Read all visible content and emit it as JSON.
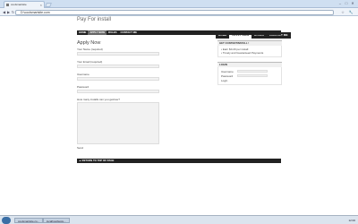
{
  "browser": {
    "tab_title": "coolsmartsite",
    "new_tab": "+",
    "window_buttons": [
      "–",
      "□",
      "✕"
    ],
    "address": "D:\\coolsmartsite.com",
    "nav": [
      "◀",
      "▶",
      "↻"
    ],
    "right_tools": [
      "☆",
      "🔧"
    ]
  },
  "site": {
    "title": "Pay For install",
    "top_nav": [
      {
        "label": "HOME"
      },
      {
        "label": "APPLY NOW"
      },
      {
        "label": "RULES"
      },
      {
        "label": "CONTACT ME"
      }
    ],
    "main_nav": [
      {
        "label": "HOME"
      },
      {
        "label": "APPLY NOW"
      },
      {
        "label": "RULES"
      },
      {
        "label": "CONTACT ME"
      }
    ]
  },
  "form": {
    "heading": "Apply Now",
    "fields": [
      {
        "label": "Your Name (required)"
      },
      {
        "label": "Your Email (required)"
      },
      {
        "label": "Username"
      },
      {
        "label": "Password"
      }
    ],
    "textarea_label": "How many installs can you get/use?",
    "send_label": "Send"
  },
  "sidebar": {
    "box1_title": "GET CONTENTINSTALL !",
    "box1_items": [
      "Earn $0.20 per install",
      "Timely and Guaranteed Payments"
    ],
    "login_title": "LOGIN",
    "login_username": "Username",
    "login_password": "Password",
    "login_button": "Login"
  },
  "footer": {
    "label": "▲ RETURN TO TOP OF PAGE"
  },
  "taskbar": {
    "tasks": [
      "coolsmartsite.co...",
      "localhost/tests..."
    ],
    "tray": "12:00"
  }
}
